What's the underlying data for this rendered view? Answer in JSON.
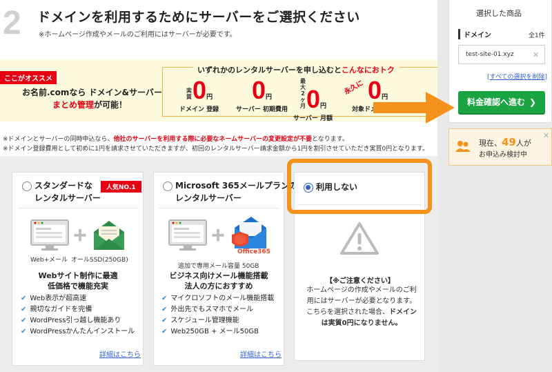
{
  "header": {
    "step_number": "2",
    "title": "ドメインを利用するためにサーバーをご選択ください",
    "subtitle": "※ホームページ作成やメールのご利用にはサーバーが必要です。"
  },
  "promo": {
    "badge": "ここがオススメ",
    "line1": "お名前.comなら ドメイン&サーバー の",
    "line2_hl": "まとめ管理",
    "line2_rest": "が可能！",
    "head_pre": "いずれかのレンタルサーバーを申し込むと",
    "head_hl": "こんなにおトク",
    "prices": [
      {
        "pre": "実質",
        "value": "0",
        "unit": "円",
        "label": "ドメイン 登録"
      },
      {
        "pre": "",
        "value": "0",
        "unit": "円",
        "label": "サーバー 初期費用"
      },
      {
        "pre": "最大2ヶ月",
        "value": "0",
        "unit": "円",
        "label": "サーバー 月額"
      },
      {
        "pre": "",
        "value": "0",
        "unit": "円",
        "label": "対象ドメイン 更新"
      }
    ],
    "forever": "永久に"
  },
  "notes": {
    "note1_pre": "※ドメインとサーバーの同時申込なら、",
    "note1_hl": "他社のサーバーを利用する際に必要なネームサーバーの変更設定が不要",
    "note1_post": "となります。",
    "note2": "※ドメイン登録費用として初めに1円を請求させていただきますが、初回のレンタルサーバー請求金額から1円を割引させていただき実質0円となります。"
  },
  "cards": [
    {
      "title": "スタンダードな\nレンタルサーバー",
      "title_l1": "スタンダードな",
      "title_l2": "レンタルサーバー",
      "ribbon": "人気NO.1",
      "cap_left": "Web+メール",
      "cap_right": "オールSSD(250GB)",
      "feature_l1": "Webサイト制作に最適",
      "feature_l2": "低価格で機能充実",
      "checks": [
        "Web表示が超高速",
        "親切なガイドを完備",
        "WordPress引っ越し機能あり",
        "WordPressかんたんインストール"
      ],
      "link": "詳細はこちら",
      "selected": false
    },
    {
      "title_l1": "Microsoft 365メールプランの",
      "title_l2": "レンタルサーバー",
      "brand": "Office365",
      "cap": "追加で専用メール容量 50GB",
      "feature_l1": "ビジネス向けメール機能搭載",
      "feature_l2": "法人の方におすすめ",
      "checks": [
        "マイクロソフトのメール機能搭載",
        "外出先でもスマホでメール",
        "スケジュール管理機能",
        "Web250GB + メール50GB"
      ],
      "link": "詳細はこちら",
      "selected": false
    },
    {
      "title_l1": "利用しない",
      "notice_title": "【※ご注意ください】",
      "notice_l1": "ホームページの作成やメールのご利",
      "notice_l2": "用にはサーバーが必要となります。",
      "notice_l3": "こちらを選択された場合、",
      "notice_l3_bold": "ドメイン",
      "notice_l4_bold": "は実質0円になりません。",
      "selected": true
    }
  ],
  "sidebar": {
    "heading": "選択した商品",
    "section": "ドメイン",
    "count": "全1件",
    "item": "test-site-01.xyz",
    "clear_bracket_open": "[",
    "clear_link": "すべての選択を削除",
    "clear_bracket_close": "]",
    "cta": "料金確認へ進む",
    "cta_arrow": "❯"
  },
  "viewers": {
    "prefix": "現在、",
    "count": "49",
    "suffix": "人が",
    "line2": "お申込み検討中"
  },
  "colors": {
    "accent_red": "#e60012",
    "orange": "#f5921b",
    "cta_green": "#1aa542",
    "link_blue": "#2f64d6"
  }
}
